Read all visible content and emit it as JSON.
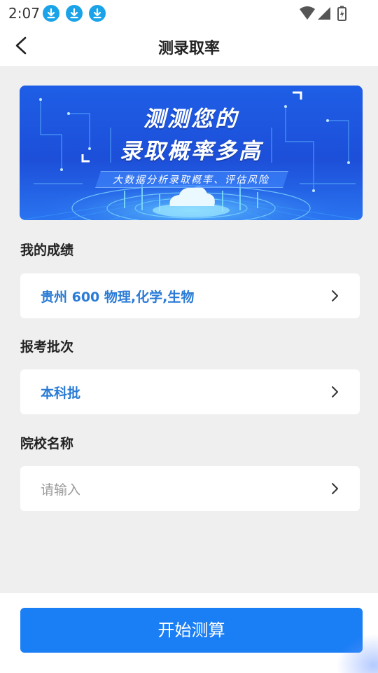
{
  "status_bar": {
    "time": "2:07",
    "notification_icons": [
      "download-icon",
      "download-icon",
      "download-icon"
    ],
    "system_icons": [
      "wifi-icon",
      "signal-icon",
      "battery-icon"
    ]
  },
  "header": {
    "back_icon": "chevron-left-icon",
    "title": "测录取率"
  },
  "banner": {
    "headline_1": "测测您的",
    "headline_2": "录取概率多高",
    "subtitle": "大数据分析录取概率、评估风险"
  },
  "form": {
    "score": {
      "label": "我的成绩",
      "value": "贵州 600 物理,化学,生物"
    },
    "batch": {
      "label": "报考批次",
      "value": "本科批"
    },
    "school": {
      "label": "院校名称",
      "placeholder": "请输入"
    }
  },
  "footer": {
    "button_label": "开始测算"
  },
  "colors": {
    "accent": "#1a7ef5",
    "value_text": "#2a7bd6",
    "background": "#efefef",
    "banner": "#1e5ee6",
    "download_badge": "#1aa3e8"
  }
}
